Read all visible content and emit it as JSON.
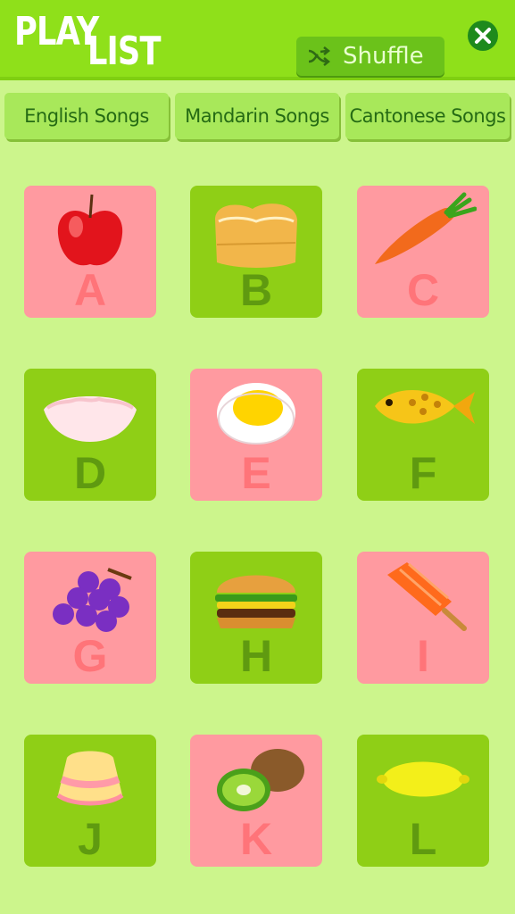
{
  "header": {
    "logo_word1": "PLAY",
    "logo_word2": "LIST",
    "shuffle_label": "Shuffle",
    "close_icon": "close-icon"
  },
  "tabs": [
    {
      "label": "English Songs"
    },
    {
      "label": "Mandarin Songs"
    },
    {
      "label": "Cantonese Songs"
    }
  ],
  "tiles": [
    {
      "letter": "A",
      "item": "apple-icon",
      "color": "pink"
    },
    {
      "letter": "B",
      "item": "bread-icon",
      "color": "green"
    },
    {
      "letter": "C",
      "item": "carrot-icon",
      "color": "pink"
    },
    {
      "letter": "D",
      "item": "dumpling-icon",
      "color": "green"
    },
    {
      "letter": "E",
      "item": "egg-icon",
      "color": "pink"
    },
    {
      "letter": "F",
      "item": "fish-icon",
      "color": "green"
    },
    {
      "letter": "G",
      "item": "grapes-icon",
      "color": "pink"
    },
    {
      "letter": "H",
      "item": "hamburger-icon",
      "color": "green"
    },
    {
      "letter": "I",
      "item": "ice-pop-icon",
      "color": "pink"
    },
    {
      "letter": "J",
      "item": "jelly-icon",
      "color": "green"
    },
    {
      "letter": "K",
      "item": "kiwi-icon",
      "color": "pink"
    },
    {
      "letter": "L",
      "item": "lemon-icon",
      "color": "green"
    }
  ],
  "colors": {
    "header_bg": "#8fe01a",
    "page_bg": "#ccf58c",
    "tile_pink": "#ff9aa0",
    "tile_green": "#8fcf16"
  }
}
